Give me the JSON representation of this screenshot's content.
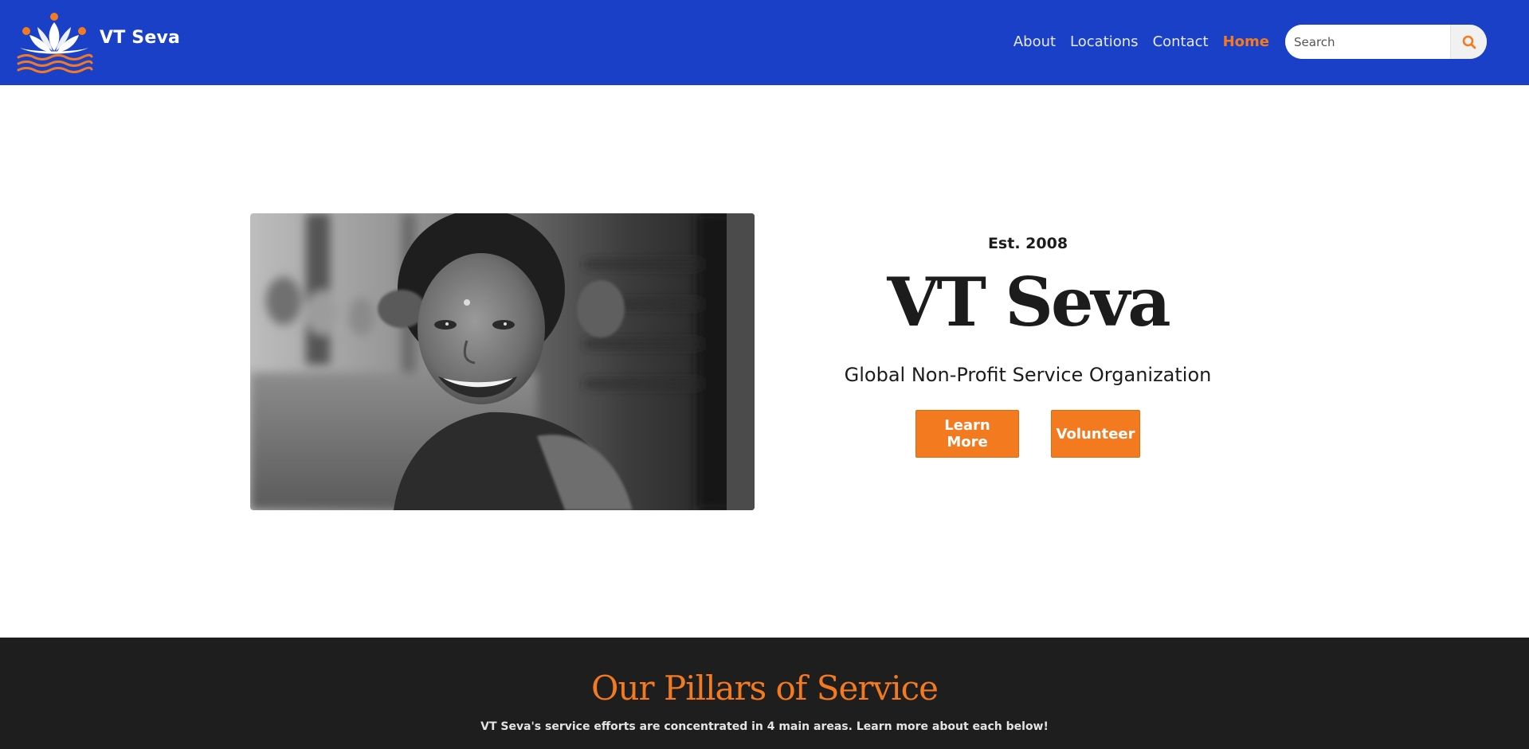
{
  "header": {
    "brand_name": "VT Seva",
    "logo_icon": "lotus-waves-logo",
    "nav": [
      {
        "label": "About"
      },
      {
        "label": "Locations"
      },
      {
        "label": "Contact"
      },
      {
        "label": "Home",
        "active": true
      }
    ],
    "search": {
      "placeholder": "Search",
      "value": "",
      "icon": "search-icon"
    }
  },
  "hero": {
    "image": "smiling-girl-bw-photo",
    "established": "Est. 2008",
    "title": "VT Seva",
    "subtitle": "Global Non-Profit Service Organization",
    "buttons": {
      "learn_more": "Learn More",
      "volunteer": "Volunteer"
    }
  },
  "pillars": {
    "title": "Our Pillars of Service",
    "description": "VT Seva's service efforts are concentrated in 4 main areas. Learn more about each below!"
  },
  "colors": {
    "header_bg": "#1b40c8",
    "accent": "#f47a20",
    "dark_section_bg": "#1e1e1e",
    "text_dark": "#1c1c1c"
  }
}
